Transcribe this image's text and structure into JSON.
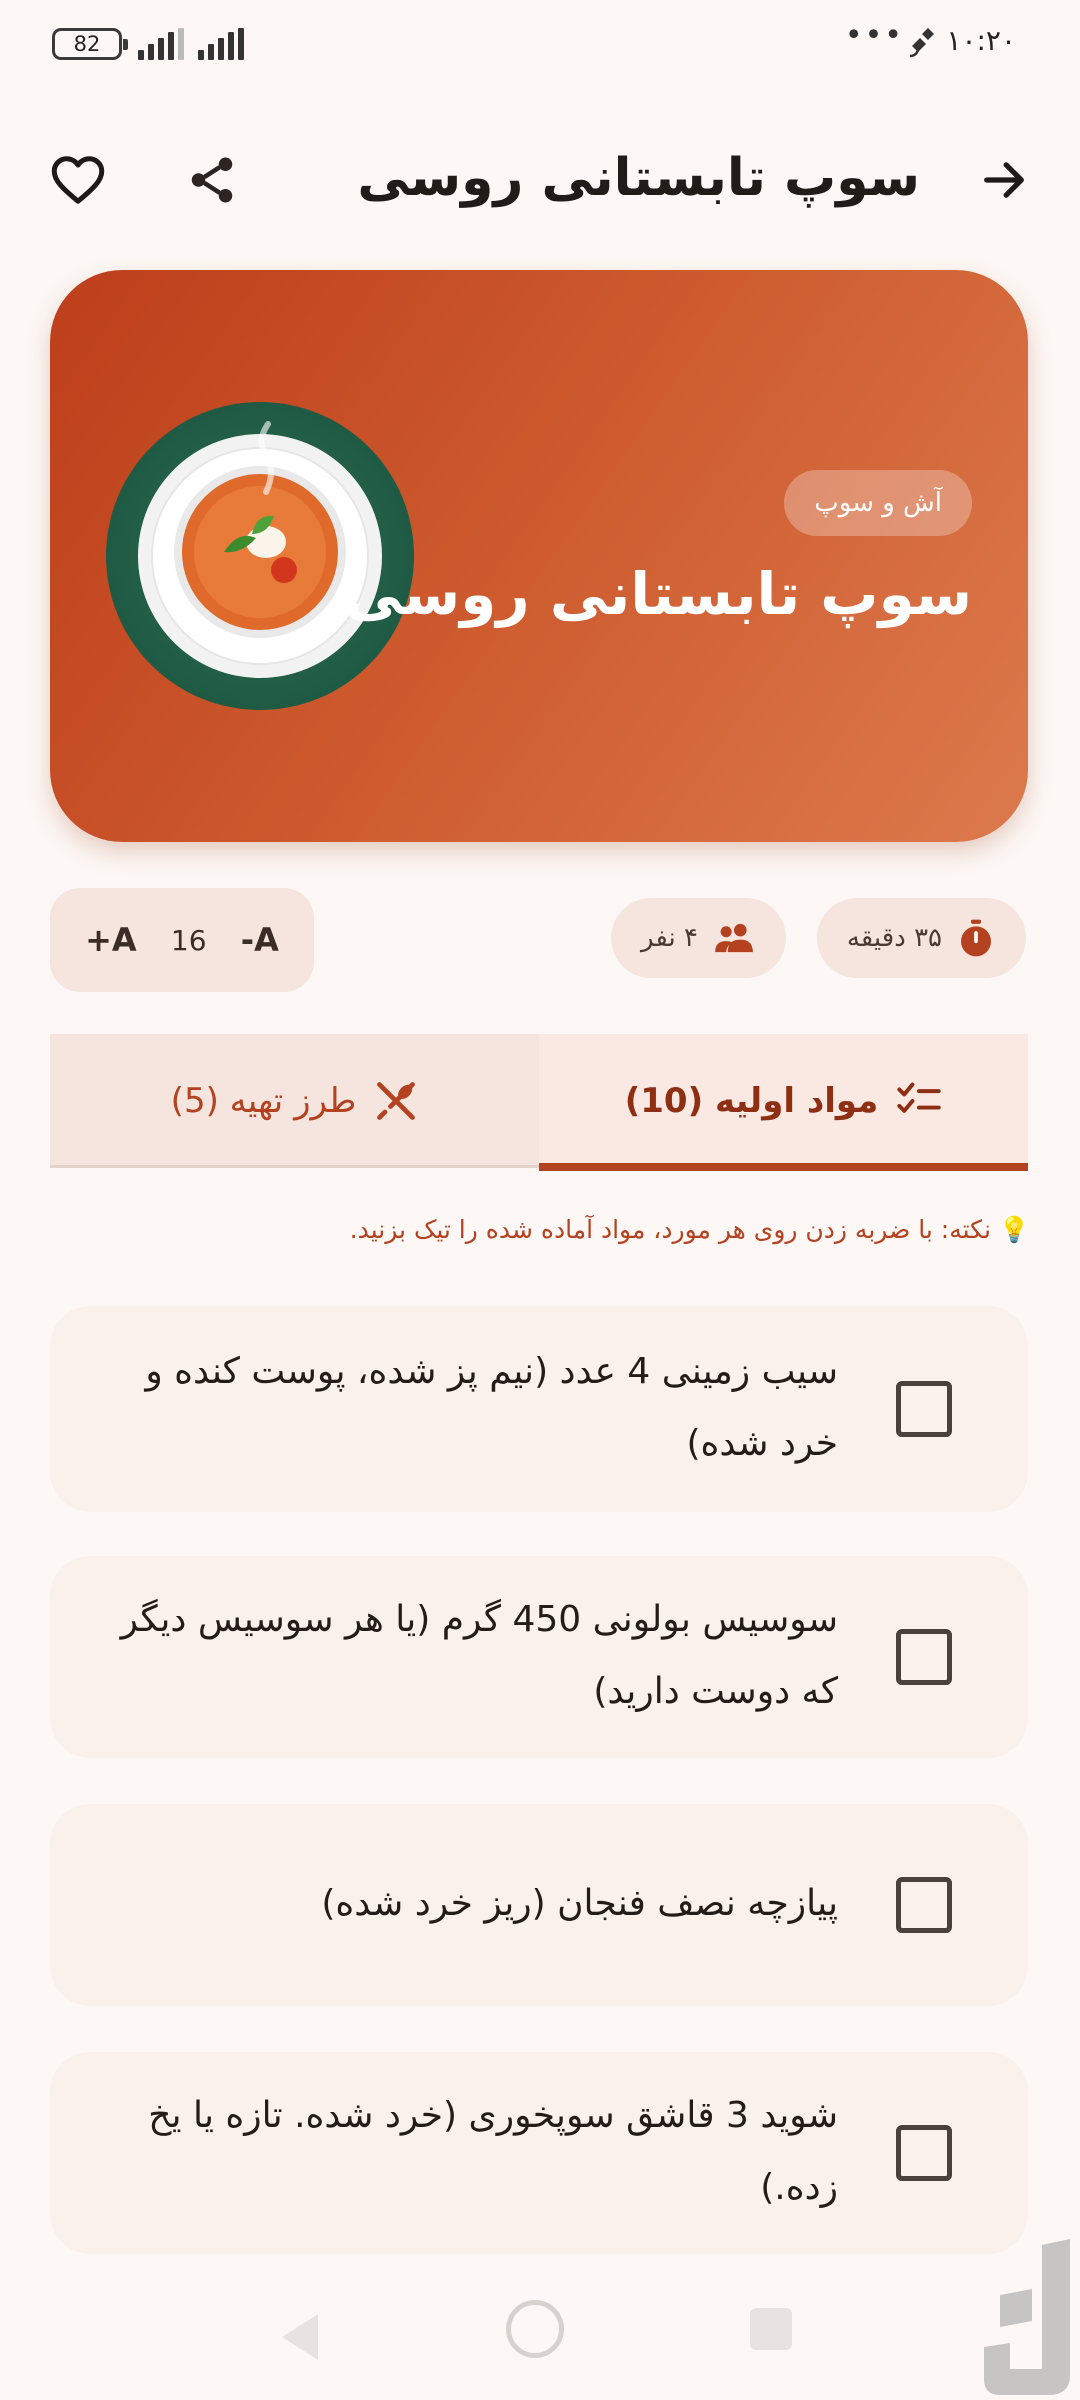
{
  "status_bar": {
    "battery": "82",
    "time": "۱۰:۲۰",
    "dots": "•••"
  },
  "app_bar": {
    "title": "سوپ تابستانی روسی"
  },
  "hero": {
    "category": "آش و سوپ",
    "title": "سوپ تابستانی روسی"
  },
  "info": {
    "time": "۳۵ دقیقه",
    "servings": "۴ نفر",
    "font_decrease": "-A",
    "font_size": "16",
    "font_increase": "+A"
  },
  "tabs": [
    {
      "label": "مواد اولیه (10)",
      "active": true,
      "icon": "checklist-icon"
    },
    {
      "label": "طرز تهیه (5)",
      "active": false,
      "icon": "utensils-icon"
    }
  ],
  "tip": "💡 نکته: با ضربه زدن روی هر مورد، مواد آماده شده را تیک بزنید.",
  "ingredients": [
    {
      "text": "سیب زمینی 4 عدد (نیم پز شده، پوست کنده و خرد شده)",
      "checked": false
    },
    {
      "text": "سوسیس بولونی 450 گرم (یا هر سوسیس دیگر که دوست دارید)",
      "checked": false
    },
    {
      "text": "پیازچه نصف فنجان (ریز خرد شده)",
      "checked": false
    },
    {
      "text": "شوید 3 قاشق سوپخوری (خرد شده. تازه یا یخ زده.)",
      "checked": false
    }
  ],
  "colors": {
    "accent": "#B4411F",
    "background": "#FDF8F5",
    "hero_start": "#BD3E1B",
    "hero_end": "#DC7A4D"
  }
}
